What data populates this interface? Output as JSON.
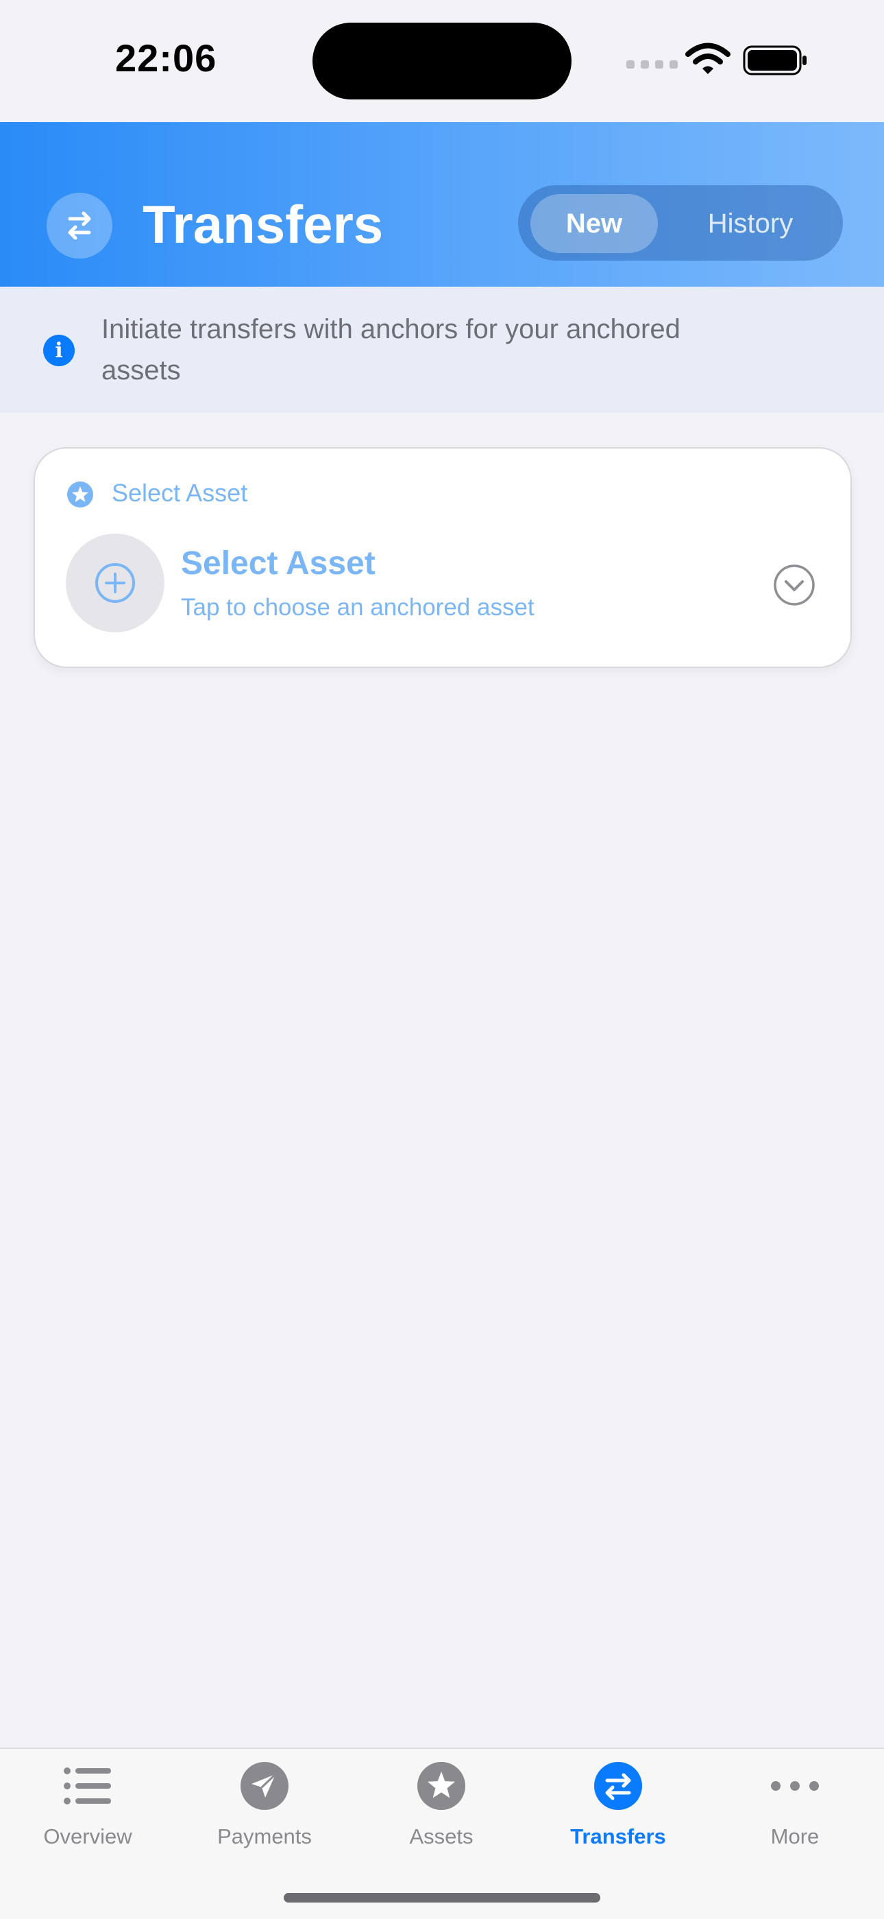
{
  "status_bar": {
    "time": "22:06",
    "icons": [
      "cellular-signal-icon",
      "wifi-icon",
      "battery-icon"
    ]
  },
  "header": {
    "title": "Transfers",
    "icon": "arrows-exchange-icon",
    "segments": [
      {
        "label": "New",
        "selected": true
      },
      {
        "label": "History",
        "selected": false
      }
    ]
  },
  "info_banner": {
    "icon": "info-circle-icon",
    "text": "Initiate transfers with anchors for your anchored assets"
  },
  "asset_card": {
    "label": "Select Asset",
    "label_icon": "star-circle-icon",
    "title": "Select Asset",
    "subtitle": "Tap to choose an anchored asset",
    "add_icon": "plus-circle-icon",
    "chevron_icon": "chevron-down-circle-icon"
  },
  "tab_bar": {
    "tabs": [
      {
        "label": "Overview",
        "icon": "list-icon",
        "active": false
      },
      {
        "label": "Payments",
        "icon": "paper-plane-icon",
        "active": false
      },
      {
        "label": "Assets",
        "icon": "star-circle-icon",
        "active": false
      },
      {
        "label": "Transfers",
        "icon": "arrows-exchange-icon",
        "active": true
      },
      {
        "label": "More",
        "icon": "more-dots-icon",
        "active": false
      }
    ]
  },
  "colors": {
    "accent": "#0A7AFF",
    "header_gradient_start": "#2A8BF7",
    "header_gradient_end": "#7CB9FB",
    "muted_blue": "#7AB5F5",
    "background": "#F2F2F7"
  }
}
